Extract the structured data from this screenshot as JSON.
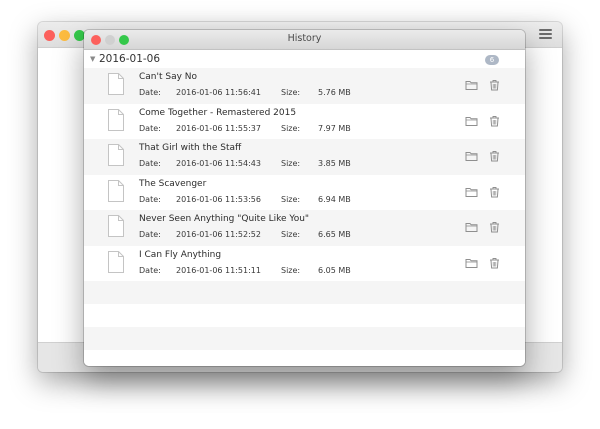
{
  "window": {
    "title": "History"
  },
  "group": {
    "toggle": "▼",
    "date": "2016-01-06",
    "badge": "6"
  },
  "labels": {
    "date": "Date:",
    "size": "Size:"
  },
  "items": [
    {
      "title": "Can't Say No",
      "date": "2016-01-06 11:56:41",
      "size": "5.76 MB"
    },
    {
      "title": "Come Together - Remastered 2015",
      "date": "2016-01-06 11:55:37",
      "size": "7.97 MB"
    },
    {
      "title": "That Girl with the Staff",
      "date": "2016-01-06 11:54:43",
      "size": "3.85 MB"
    },
    {
      "title": "The Scavenger",
      "date": "2016-01-06 11:53:56",
      "size": "6.94 MB"
    },
    {
      "title": "Never Seen Anything \"Quite Like You\"",
      "date": "2016-01-06 11:52:52",
      "size": "6.65 MB"
    },
    {
      "title": "I Can Fly Anything",
      "date": "2016-01-06 11:51:11",
      "size": "6.05 MB"
    }
  ],
  "icons": {
    "file": "document-icon",
    "folder": "folder-icon",
    "trash": "trash-icon",
    "menu": "hamburger-menu-icon"
  },
  "colors": {
    "close": "#fc605c",
    "minimize": "#fdbc40",
    "zoom": "#34c84a",
    "disabled": "#d0d0d0",
    "badge": "#aeb8c6",
    "stripe": "#f5f5f5"
  }
}
